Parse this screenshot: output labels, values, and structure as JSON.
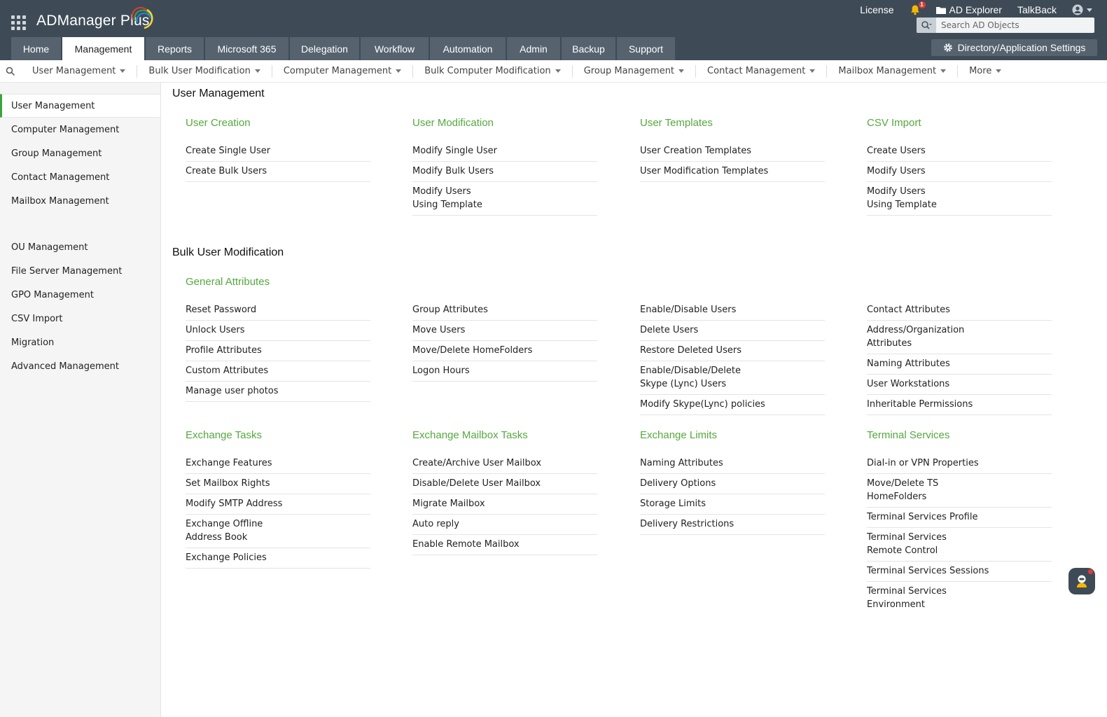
{
  "app": {
    "name": "ADManager Plus"
  },
  "top_links": {
    "license": "License",
    "notification_count": "1",
    "ad_explorer": "AD Explorer",
    "talkback": "TalkBack"
  },
  "search": {
    "placeholder": "Search AD Objects"
  },
  "main_tabs": [
    {
      "label": "Home"
    },
    {
      "label": "Management",
      "active": true
    },
    {
      "label": "Reports"
    },
    {
      "label": "Microsoft 365"
    },
    {
      "label": "Delegation"
    },
    {
      "label": "Workflow"
    },
    {
      "label": "Automation"
    },
    {
      "label": "Admin"
    },
    {
      "label": "Backup"
    },
    {
      "label": "Support"
    }
  ],
  "settings_button": {
    "label": "Directory/Application Settings"
  },
  "subnav": [
    {
      "label": "User Management"
    },
    {
      "label": "Bulk User Modification"
    },
    {
      "label": "Computer Management"
    },
    {
      "label": "Bulk Computer Modification"
    },
    {
      "label": "Group Management"
    },
    {
      "label": "Contact Management"
    },
    {
      "label": "Mailbox Management"
    },
    {
      "label": "More"
    }
  ],
  "sidebar": [
    {
      "label": "User Management",
      "active": true
    },
    {
      "label": "Computer Management"
    },
    {
      "label": "Group Management"
    },
    {
      "label": "Contact Management"
    },
    {
      "label": "Mailbox Management"
    },
    {
      "label": "OU Management"
    },
    {
      "label": "File Server Management"
    },
    {
      "label": "GPO Management"
    },
    {
      "label": "CSV Import"
    },
    {
      "label": "Migration"
    },
    {
      "label": "Advanced Management"
    }
  ],
  "sections": [
    {
      "title": "User Management",
      "groups": [
        {
          "title": "User Creation",
          "links": [
            "Create Single User",
            "Create Bulk Users"
          ]
        },
        {
          "title": "User Modification",
          "links": [
            "Modify Single User",
            "Modify Bulk Users",
            "Modify Users Using Template"
          ]
        },
        {
          "title": "User Templates",
          "links": [
            "User Creation Templates",
            "User Modification Templates"
          ]
        },
        {
          "title": "CSV Import",
          "links": [
            "Create Users",
            "Modify Users",
            "Modify Users Using Template"
          ]
        }
      ]
    },
    {
      "title": "Bulk User Modification",
      "groups": [
        {
          "title": "General Attributes",
          "links": [
            "Reset Password",
            "Unlock Users",
            "Profile Attributes",
            "Custom Attributes",
            "Manage user photos"
          ]
        },
        {
          "title": "",
          "links": [
            "Group Attributes",
            "Move Users",
            "Move/Delete HomeFolders",
            "Logon Hours"
          ]
        },
        {
          "title": "",
          "links": [
            "Enable/Disable Users",
            "Delete Users",
            "Restore Deleted Users",
            "Enable/Disable/Delete Skype (Lync) Users",
            "Modify Skype(Lync) policies"
          ]
        },
        {
          "title": "",
          "links": [
            "Contact Attributes",
            "Address/Organization Attributes",
            "Naming Attributes",
            "User Workstations",
            "Inheritable Permissions"
          ]
        },
        {
          "title": "Exchange Tasks",
          "links": [
            "Exchange Features",
            "Set Mailbox Rights",
            "Modify SMTP Address",
            "Exchange Offline Address Book",
            "Exchange Policies"
          ]
        },
        {
          "title": "Exchange Mailbox Tasks",
          "links": [
            "Create/Archive User Mailbox",
            "Disable/Delete User Mailbox",
            "Migrate Mailbox",
            "Auto reply",
            "Enable Remote Mailbox"
          ]
        },
        {
          "title": "Exchange Limits",
          "links": [
            "Naming Attributes",
            "Delivery Options",
            "Storage Limits",
            "Delivery Restrictions"
          ]
        },
        {
          "title": "Terminal Services",
          "links": [
            "Dial-in or VPN Properties",
            "Move/Delete TS HomeFolders",
            "Terminal Services Profile",
            "Terminal Services Remote Control",
            "Terminal Services Sessions",
            "Terminal Services Environment"
          ]
        }
      ]
    }
  ],
  "colors": {
    "header_bg": "#3e4b57",
    "tab_bg": "#56636f",
    "accent_green": "#56a83f",
    "sidebar_active_border": "#3aa53a"
  }
}
